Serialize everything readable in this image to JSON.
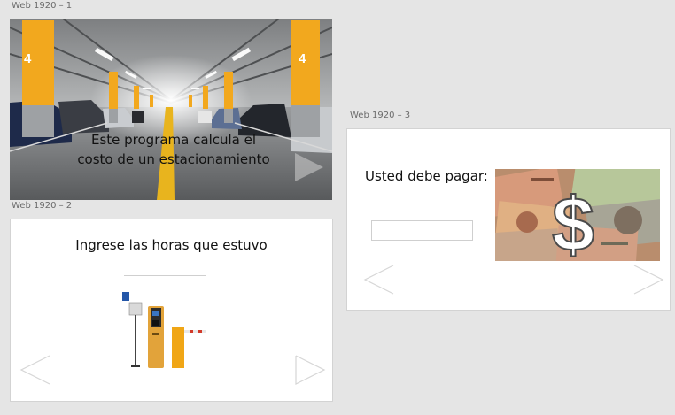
{
  "artboards": {
    "intro": {
      "label": "Web 1920 – 1",
      "text_line1": "Este programa calcula el",
      "text_line2": "costo de un estacionamiento",
      "pillar_text": "4"
    },
    "hours": {
      "label": "Web 1920 – 2",
      "prompt": "Ingrese las horas que estuvo",
      "hours_value": ""
    },
    "result": {
      "label": "Web 1920 – 3",
      "pay_label": "Usted debe pagar:",
      "amount_value": "",
      "dollar_sign": "$"
    }
  },
  "icons": {
    "next": "arrow-right-icon",
    "prev": "arrow-left-icon"
  },
  "colors": {
    "canvas": "#e5e5e5",
    "pillar": "#f2a81e",
    "barrier": "#f0a616",
    "arrow": "#d6d6d6"
  }
}
